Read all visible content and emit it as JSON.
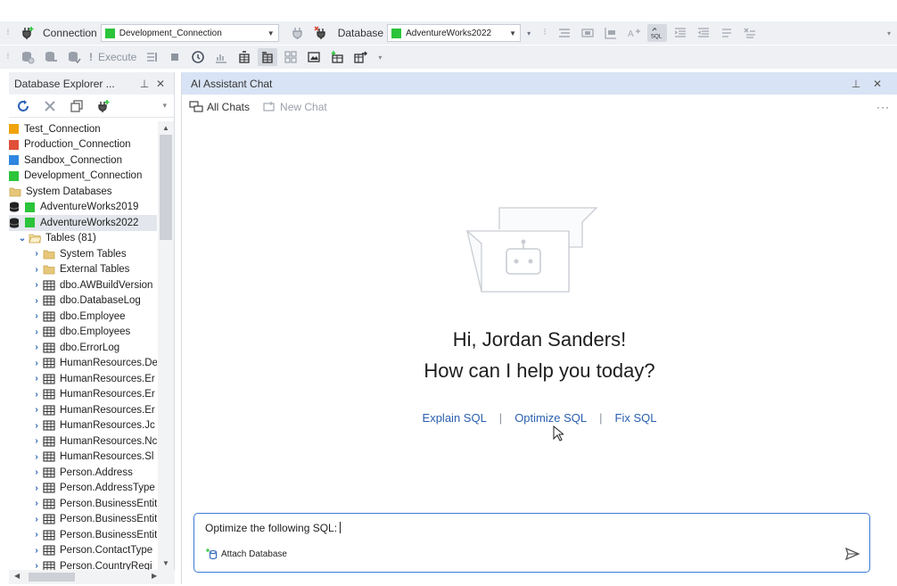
{
  "toolbar1": {
    "connection_label": "Connection",
    "connection_value": "Development_Connection",
    "database_label": "Database",
    "database_value": "AdventureWorks2022"
  },
  "toolbar2": {
    "execute_label": "Execute"
  },
  "explorer": {
    "title": "Database Explorer ...",
    "tree": [
      {
        "label": "Test_Connection",
        "color": "#f0a30a",
        "kind": "conn",
        "level": 0
      },
      {
        "label": "Production_Connection",
        "color": "#e0503a",
        "kind": "conn",
        "level": 0
      },
      {
        "label": "Sandbox_Connection",
        "color": "#2f86e0",
        "kind": "conn",
        "level": 0
      },
      {
        "label": "Development_Connection",
        "color": "#2bc43a",
        "kind": "conn",
        "level": 0
      },
      {
        "label": "System Databases",
        "kind": "folder",
        "level": 0
      },
      {
        "label": "AdventureWorks2019",
        "color": "#2bc43a",
        "kind": "db",
        "level": 0
      },
      {
        "label": "AdventureWorks2022",
        "color": "#2bc43a",
        "kind": "db",
        "level": 0,
        "selected": true
      },
      {
        "label": "Tables (81)",
        "kind": "folder-open",
        "level": 1,
        "expanded": true
      },
      {
        "label": "System Tables",
        "kind": "folder",
        "level": 2
      },
      {
        "label": "External Tables",
        "kind": "folder",
        "level": 2
      },
      {
        "label": "dbo.AWBuildVersion",
        "kind": "table",
        "level": 2
      },
      {
        "label": "dbo.DatabaseLog",
        "kind": "table",
        "level": 2
      },
      {
        "label": "dbo.Employee",
        "kind": "table",
        "level": 2
      },
      {
        "label": "dbo.Employees",
        "kind": "table",
        "level": 2
      },
      {
        "label": "dbo.ErrorLog",
        "kind": "table",
        "level": 2
      },
      {
        "label": "HumanResources.De",
        "kind": "table",
        "level": 2
      },
      {
        "label": "HumanResources.Er",
        "kind": "table",
        "level": 2
      },
      {
        "label": "HumanResources.Er",
        "kind": "table",
        "level": 2
      },
      {
        "label": "HumanResources.Er",
        "kind": "table",
        "level": 2
      },
      {
        "label": "HumanResources.Jc",
        "kind": "table",
        "level": 2
      },
      {
        "label": "HumanResources.Nc",
        "kind": "table",
        "level": 2
      },
      {
        "label": "HumanResources.Sl",
        "kind": "table",
        "level": 2
      },
      {
        "label": "Person.Address",
        "kind": "table",
        "level": 2
      },
      {
        "label": "Person.AddressType",
        "kind": "table",
        "level": 2
      },
      {
        "label": "Person.BusinessEntit",
        "kind": "table",
        "level": 2
      },
      {
        "label": "Person.BusinessEntit",
        "kind": "table",
        "level": 2
      },
      {
        "label": "Person.BusinessEntit",
        "kind": "table",
        "level": 2
      },
      {
        "label": "Person.ContactType",
        "kind": "table",
        "level": 2
      },
      {
        "label": "Person.CountryRegi",
        "kind": "table",
        "level": 2
      }
    ]
  },
  "chat": {
    "title": "AI Assistant Chat",
    "all_chats": "All Chats",
    "new_chat": "New Chat",
    "more": "···",
    "greeting": "Hi, Jordan Sanders!",
    "question": "How can I help you today?",
    "suggestions": [
      "Explain SQL",
      "Optimize SQL",
      "Fix SQL"
    ],
    "input_value": "Optimize the following SQL:",
    "attach_label": "Attach Database"
  }
}
